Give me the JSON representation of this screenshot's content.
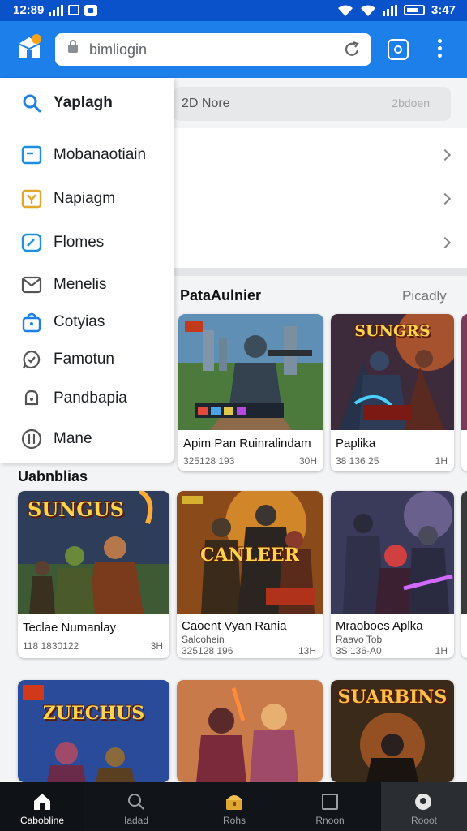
{
  "status_bar": {
    "time": "12:89",
    "right_time": "3:47"
  },
  "browser": {
    "url_text": "bimliogin"
  },
  "background_page": {
    "search_left": "2D Nore",
    "search_right": "2bdoen",
    "section_title": "PataAulnier",
    "section_link": "Picadly"
  },
  "drawer": {
    "items": [
      {
        "label": "Yaplagh",
        "icon": "search-icon"
      },
      {
        "label": "Mobanaotiain",
        "icon": "minus-box-icon"
      },
      {
        "label": "Napiagm",
        "icon": "y-box-icon"
      },
      {
        "label": "Flomes",
        "icon": "gauge-icon"
      },
      {
        "label": "Menelis",
        "icon": "mail-icon"
      },
      {
        "label": "Cotyias",
        "icon": "bag-icon"
      },
      {
        "label": "Famotun",
        "icon": "chat-check-icon"
      },
      {
        "label": "Pandbapia",
        "icon": "bell-icon"
      },
      {
        "label": "Mane",
        "icon": "slider-circle-icon"
      }
    ]
  },
  "section2_title": "Uabnblias",
  "cards_row1": [
    {
      "title": "Apim Pan Ruinralindam",
      "meta": "325128 193",
      "meta2": "30H"
    },
    {
      "title": "Paplika",
      "meta": "38 136 25",
      "meta2": "1H"
    }
  ],
  "cards_row2": [
    {
      "title": "Teclae Numanlay",
      "sub": "",
      "meta": "118 1830122",
      "meta2": "3H"
    },
    {
      "title": "Caoent Vyan Rania",
      "sub": "Salcohein",
      "meta": "325128 196",
      "meta2": "13H"
    },
    {
      "title": "Mraoboes Aplka",
      "sub": "Raavo Tob",
      "meta": "3S 136-A0",
      "meta2": "1H"
    }
  ],
  "art_titles": {
    "r1c2": "SUNGRS",
    "r2c1": "SUNGUS",
    "r2c2": "CANLEER",
    "r3c1": "ZUECHUS",
    "r3c2": "",
    "r3c3": "SUARBINS"
  },
  "bottom_nav": [
    {
      "label": "Cabobline"
    },
    {
      "label": "Iadad"
    },
    {
      "label": "Rohs"
    },
    {
      "label": "Rnoon"
    },
    {
      "label": "Rooot"
    }
  ],
  "colors": {
    "appbar": "#1c7fea",
    "statusbar": "#0a52c9",
    "accent": "#1c7fea"
  }
}
